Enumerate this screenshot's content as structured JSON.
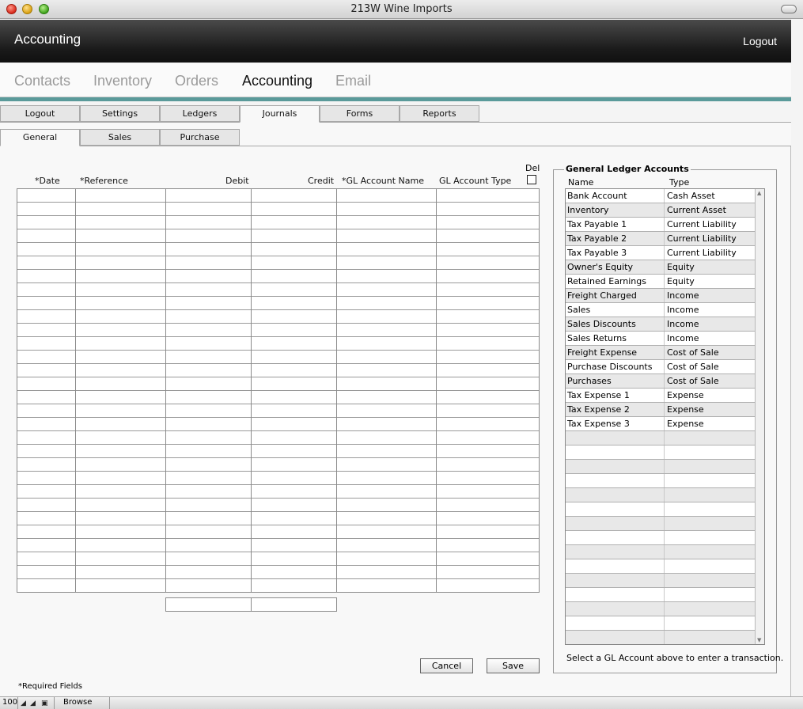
{
  "window": {
    "title": "213W Wine Imports"
  },
  "header": {
    "title": "Accounting",
    "logout": "Logout"
  },
  "main_nav": [
    "Contacts",
    "Inventory",
    "Orders",
    "Accounting",
    "Email"
  ],
  "tabs_primary": [
    "Logout",
    "Settings",
    "Ledgers",
    "Journals",
    "Forms",
    "Reports"
  ],
  "tabs_secondary": [
    "General",
    "Sales",
    "Purchase"
  ],
  "journal": {
    "columns": [
      "*Date",
      "*Reference",
      "Debit",
      "Credit",
      "*GL Account Name",
      "GL Account Type"
    ],
    "del_label": "Del"
  },
  "buttons": {
    "cancel": "Cancel",
    "save": "Save"
  },
  "required_note": "*Required Fields",
  "gl_panel": {
    "title": "General Ledger Accounts",
    "col_name": "Name",
    "col_type": "Type",
    "hint": "Select a GL Account above to enter a transaction.",
    "accounts": [
      {
        "name": "Bank Account",
        "type": "Cash Asset"
      },
      {
        "name": "Inventory",
        "type": "Current Asset"
      },
      {
        "name": "Tax Payable 1",
        "type": "Current Liability"
      },
      {
        "name": "Tax Payable 2",
        "type": "Current Liability"
      },
      {
        "name": "Tax Payable 3",
        "type": "Current Liability"
      },
      {
        "name": "Owner's Equity",
        "type": "Equity"
      },
      {
        "name": "Retained Earnings",
        "type": "Equity"
      },
      {
        "name": "Freight Charged",
        "type": "Income"
      },
      {
        "name": "Sales",
        "type": "Income"
      },
      {
        "name": "Sales Discounts",
        "type": "Income"
      },
      {
        "name": "Sales Returns",
        "type": "Income"
      },
      {
        "name": "Freight Expense",
        "type": "Cost of Sale"
      },
      {
        "name": "Purchase Discounts",
        "type": "Cost of Sale"
      },
      {
        "name": "Purchases",
        "type": "Cost of Sale"
      },
      {
        "name": "Tax Expense 1",
        "type": "Expense"
      },
      {
        "name": "Tax Expense 2",
        "type": "Expense"
      },
      {
        "name": "Tax Expense 3",
        "type": "Expense"
      }
    ]
  },
  "status": {
    "zoom": "100",
    "mode": "Browse"
  }
}
